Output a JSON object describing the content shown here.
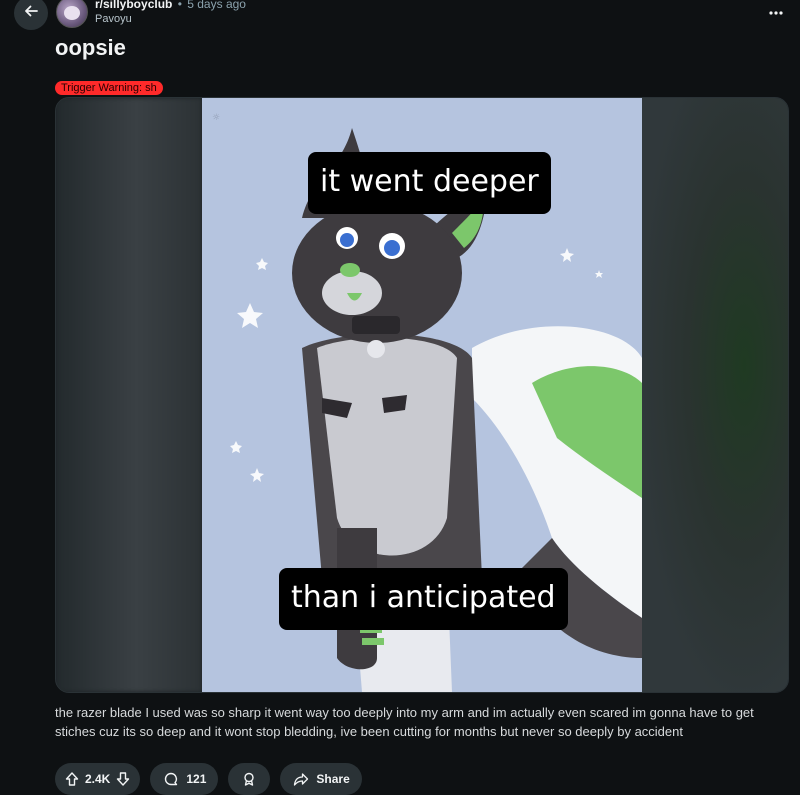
{
  "header": {
    "subreddit": "r/sillyboyclub",
    "separator": "•",
    "time_ago": "5 days ago",
    "author": "Pavoyu"
  },
  "post": {
    "title": "oopsie",
    "flair": "Trigger Warning: sh",
    "media": {
      "caption_top": "it went deeper",
      "caption_bottom": "than i anticipated",
      "art_background": "#b5c4df"
    },
    "body": "the razer blade I used was so sharp it went way too deeply into my arm and im actually even scared im gonna have to get stiches cuz its so deep and it wont stop bledding, ive been cutting for months but never so deeply by accident"
  },
  "actions": {
    "score": "2.4K",
    "comments": "121",
    "share_label": "Share"
  },
  "icons": {
    "back": "arrow-left-icon",
    "more": "ellipsis-icon",
    "upvote": "arrow-up-icon",
    "downvote": "arrow-down-icon",
    "comment": "comment-bubble-icon",
    "award": "award-icon",
    "share": "share-arrow-icon"
  },
  "colors": {
    "background": "#0e1113",
    "pill": "#2a3236",
    "flair": "#ff2a2a"
  }
}
